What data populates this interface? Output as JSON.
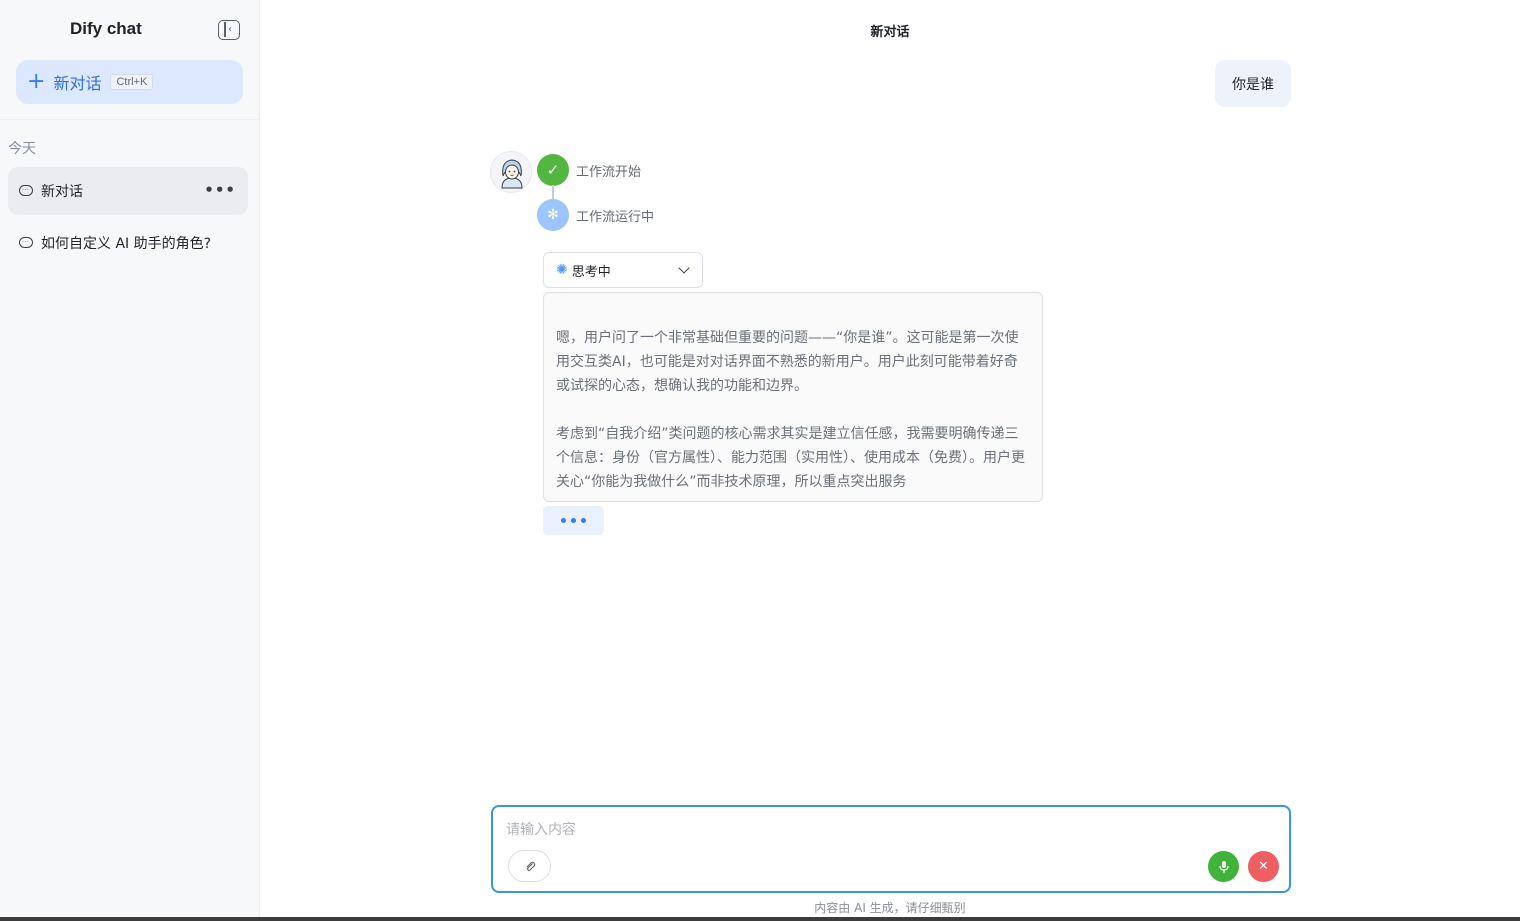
{
  "sidebar": {
    "app_title": "Dify chat",
    "new_chat_label": "新对话",
    "new_chat_shortcut": "Ctrl+K",
    "group_today": "今天",
    "conversations": [
      {
        "title": "新对话",
        "active": true
      },
      {
        "title": "如何自定义 AI 助手的角色?",
        "active": false
      }
    ],
    "more_icon_text": "•••"
  },
  "main": {
    "title": "新对话",
    "user_message": "你是谁",
    "workflow": {
      "step1": "工作流开始",
      "step2": "工作流运行中"
    },
    "thinking": {
      "label": "思考中",
      "paragraph1": "嗯，用户问了一个非常基础但重要的问题——“你是谁”。这可能是第一次使用交互类AI，也可能是对对话界面不熟悉的新用户。用户此刻可能带着好奇或试探的心态，想确认我的功能和边界。",
      "paragraph2": "考虑到“自我介绍”类问题的核心需求其实是建立信任感，我需要明确传递三个信息：身份（官方属性）、能力范围（实用性）、使用成本（免费）。用户更关心“你能为我做什么”而非技术原理，所以重点突出服务"
    }
  },
  "composer": {
    "placeholder": "请输入内容",
    "disclaimer": "内容由 AI 生成，请仔细甄别"
  },
  "colors": {
    "accent": "#3a7bf0",
    "success": "#52b640",
    "danger": "#ee5e62",
    "input_border": "#3a94e0"
  },
  "icons": [
    "collapse-sidebar-icon",
    "plus-icon",
    "chat-bubble-icon",
    "more-icon",
    "check-icon",
    "loading-spinner-icon",
    "chevron-down-icon",
    "paperclip-icon",
    "microphone-icon",
    "close-icon"
  ]
}
